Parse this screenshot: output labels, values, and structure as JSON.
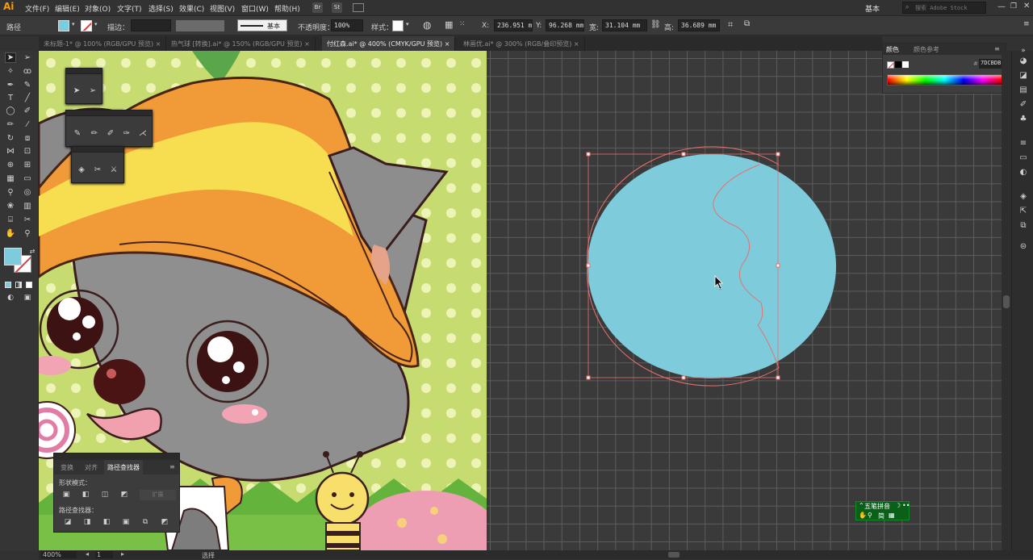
{
  "app": {
    "logo": "Ai"
  },
  "menu": [
    "文件(F)",
    "编辑(E)",
    "对象(O)",
    "文字(T)",
    "选择(S)",
    "效果(C)",
    "视图(V)",
    "窗口(W)",
    "帮助(H)"
  ],
  "menu_right": {
    "workspace": "基本",
    "search_placeholder": "搜索 Adobe Stock",
    "bridge": "Br",
    "stock": "St"
  },
  "control": {
    "object_type": "路径",
    "stroke_label": "描边：",
    "brush_label": "基本",
    "opacity_label": "不透明度：",
    "opacity_value": "100%",
    "style_label": "样式：",
    "x_label": "X:",
    "x_value": "236.951 m",
    "y_label": "Y:",
    "y_value": "96.268 mm",
    "w_label": "宽:",
    "w_value": "31.104 mm",
    "h_label": "高:",
    "h_value": "36.689 mm"
  },
  "tabs": [
    {
      "label": "未标题-1* @ 100% (RGB/GPU 预览)",
      "active": false
    },
    {
      "label": "热气球 [转换].ai* @ 150% (RGB/GPU 预览)",
      "active": false
    },
    {
      "label": "付红森.ai* @ 400% (CMYK/GPU 预览)",
      "active": true
    },
    {
      "label": "林画优.ai* @ 300% (RGB/叠印预览)",
      "active": false
    }
  ],
  "color_panel": {
    "tab_color": "颜色",
    "tab_guide": "颜色参考",
    "hex": "7DCBDB"
  },
  "pathfinder": {
    "tabs": [
      "变换",
      "对齐",
      "路径查找器"
    ],
    "shape_modes_label": "形状模式：",
    "expand_label": "扩展",
    "pathfinders_label": "路径查找器："
  },
  "ime": {
    "title": "五笔拼音",
    "row2": "简"
  },
  "status": {
    "zoom": "400%",
    "page": "1",
    "mode": "选择"
  },
  "colors": {
    "fill": "#7dcbdb",
    "selection": "#e8706f",
    "accent": "#ff9a00"
  }
}
